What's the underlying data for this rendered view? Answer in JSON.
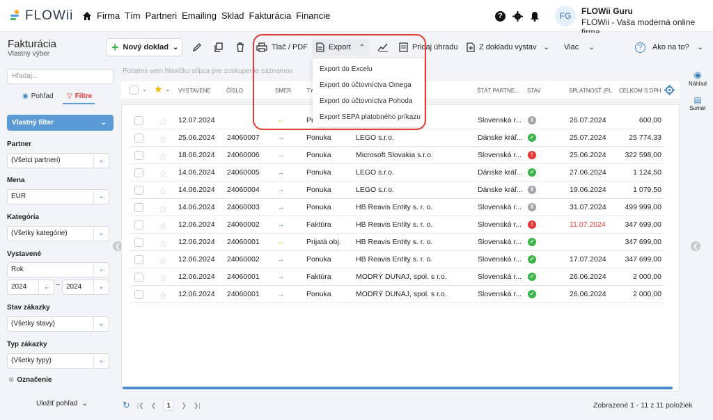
{
  "app": {
    "logo": "FLOWii"
  },
  "nav": [
    "Firma",
    "Tím",
    "Partneri",
    "Emailing",
    "Sklad",
    "Fakturácia",
    "Financie"
  ],
  "user": {
    "initials": "FG",
    "name": "FLOWii Guru",
    "company": "FLOWii - Vaša moderná online firma"
  },
  "page": {
    "title": "Fakturácia",
    "subtitle": "Vlastný výber"
  },
  "toolbar": {
    "new_doc": "Nový doklad",
    "print": "Tlač / PDF",
    "export": "Export",
    "payment": "Pridaj úhradu",
    "from_doc": "Z dokladu vystav",
    "more": "Viac",
    "help": "Ako na to?"
  },
  "export_menu": [
    "Export do Excelu",
    "Export do účtovníctva Omega",
    "Export do účtovníctva Pohoda",
    "Export SEPA platobného príkazu"
  ],
  "sidebar": {
    "search_placeholder": "Hľadaj...",
    "tab_view": "Pohľad",
    "tab_filters": "Filtre",
    "custom_filter": "Vlastný filter",
    "partner_label": "Partner",
    "partner_value": "(Všetci partneri)",
    "currency_label": "Mena",
    "currency_value": "EUR",
    "category_label": "Kategória",
    "category_value": "(Všetky kategórie)",
    "issued_label": "Vystavené",
    "issued_value": "Rok",
    "year_from": "2024",
    "year_sep": "~",
    "year_to": "2024",
    "order_status_label": "Stav zákazky",
    "order_status_value": "(Všetky stavy)",
    "order_type_label": "Typ zákazky",
    "order_type_value": "(Všetky typy)",
    "marking": "Označenie",
    "save_view": "Uložiť pohľad"
  },
  "group_hint": "Potiahni sem hlavičku stĺpca pre zoskupenie záznamov",
  "columns": [
    "VYSTAVENÉ",
    "ČÍSLO",
    "SMER",
    "TY",
    "ŠTÁT PARTNE...",
    "STAV",
    "SPLATNOSŤ (PL",
    "CELKOM S DPH"
  ],
  "rows": [
    {
      "date": "12.07.2024",
      "number": "",
      "dir": "in",
      "type": "Pri",
      "partner": "",
      "country": "Slovenská r...",
      "status": "grey",
      "due": "26.07.2024",
      "total": "600,00",
      "overdue": false
    },
    {
      "date": "25.06.2024",
      "number": "24060007",
      "dir": "out",
      "type": "Ponuka",
      "partner": "LEGO s.r.o.",
      "country": "Dánske kráľ...",
      "status": "green",
      "due": "25.07.2024",
      "total": "25 774,33",
      "overdue": false
    },
    {
      "date": "18.06.2024",
      "number": "24060006",
      "dir": "out",
      "type": "Ponuka",
      "partner": "Microsoft Slovakia s.r.o.",
      "country": "Slovenská r...",
      "status": "red",
      "due": "25.06.2024",
      "total": "322 598,00",
      "overdue": false
    },
    {
      "date": "14.06.2024",
      "number": "24060005",
      "dir": "out",
      "type": "Ponuka",
      "partner": "LEGO s.r.o.",
      "country": "Dánske kráľ...",
      "status": "green",
      "due": "27.06.2024",
      "total": "1 124,50",
      "overdue": false
    },
    {
      "date": "14.06.2024",
      "number": "24060004",
      "dir": "out",
      "type": "Ponuka",
      "partner": "LEGO s.r.o.",
      "country": "Dánske kráľ...",
      "status": "grey",
      "due": "19.06.2024",
      "total": "1 079,50",
      "overdue": false
    },
    {
      "date": "14.06.2024",
      "number": "24060003",
      "dir": "out",
      "type": "Ponuka",
      "partner": "HB Reavis Entity s. r. o.",
      "country": "Slovenská r...",
      "status": "grey",
      "due": "31.07.2024",
      "total": "499 999,00",
      "overdue": false
    },
    {
      "date": "12.06.2024",
      "number": "24060002",
      "dir": "out",
      "type": "Faktúra",
      "partner": "HB Reavis Entity s. r. o.",
      "country": "Slovenská r...",
      "status": "red",
      "due": "11.07.2024",
      "total": "347 699,00",
      "overdue": true
    },
    {
      "date": "12.06.2024",
      "number": "24060001",
      "dir": "in",
      "type": "Prijatá obj.",
      "partner": "HB Reavis Entity s. r. o.",
      "country": "Slovenská r...",
      "status": "green",
      "due": "",
      "total": "347 699,00",
      "overdue": false
    },
    {
      "date": "12.06.2024",
      "number": "24060002",
      "dir": "out",
      "type": "Ponuka",
      "partner": "HB Reavis Entity s. r. o.",
      "country": "Slovenská r...",
      "status": "green",
      "due": "17.07.2024",
      "total": "347 699,00",
      "overdue": false
    },
    {
      "date": "12.06.2024",
      "number": "24060001",
      "dir": "out",
      "type": "Faktúra",
      "partner": "MODRÝ DUNAJ, spol. s r.o.",
      "country": "Slovenská r...",
      "status": "green",
      "due": "26.06.2024",
      "total": "2 000,00",
      "overdue": false
    },
    {
      "date": "12.06.2024",
      "number": "24060001",
      "dir": "out",
      "type": "Ponuka",
      "partner": "MODRÝ DUNAJ, spol. s r.o.",
      "country": "Slovenská r...",
      "status": "green",
      "due": "26.06.2024",
      "total": "2 000,00",
      "overdue": false
    }
  ],
  "pager": {
    "page": "1",
    "summary": "Zobrazené 1 - 11 z 11 položiek"
  },
  "right_panel": {
    "preview": "Náhľad",
    "summary": "Sumár"
  },
  "colors": {
    "accent": "#3b82c4",
    "green": "#3cb54a",
    "red": "#e53935",
    "grey": "#a0a4a9",
    "in_arrow": "#f5b800",
    "out_arrow": "#4a8cc9"
  }
}
